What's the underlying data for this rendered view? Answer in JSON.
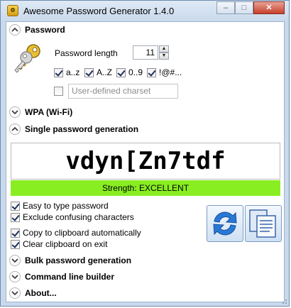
{
  "window": {
    "title": "Awesome Password Generator 1.4.0",
    "buttons": {
      "minimize": "–",
      "maximize": "□",
      "close": "✕"
    }
  },
  "password": {
    "header": "Password",
    "length_label": "Password length",
    "length_value": "11",
    "charsets": [
      {
        "label": "a..z",
        "checked": true
      },
      {
        "label": "A..Z",
        "checked": true
      },
      {
        "label": "0..9",
        "checked": true
      },
      {
        "label": "!@#...",
        "checked": true
      }
    ],
    "user_defined": {
      "checked": false,
      "placeholder": "User-defined charset"
    }
  },
  "wpa": {
    "header": "WPA (Wi-Fi)"
  },
  "single": {
    "header": "Single password generation",
    "password": "vdyn[Zn7tdf",
    "strength": "Strength: EXCELLENT",
    "strength_color": "#88ee22",
    "options": [
      {
        "label": "Easy to type password",
        "checked": true
      },
      {
        "label": "Exclude confusing characters",
        "checked": true
      },
      {
        "label": "Copy to clipboard automatically",
        "checked": true
      },
      {
        "label": "Clear clipboard on exit",
        "checked": true
      }
    ],
    "generate_icon": "refresh-icon",
    "copy_icon": "copy-icon"
  },
  "bulk": {
    "header": "Bulk password generation"
  },
  "cli": {
    "header": "Command line builder"
  },
  "about": {
    "header": "About..."
  }
}
